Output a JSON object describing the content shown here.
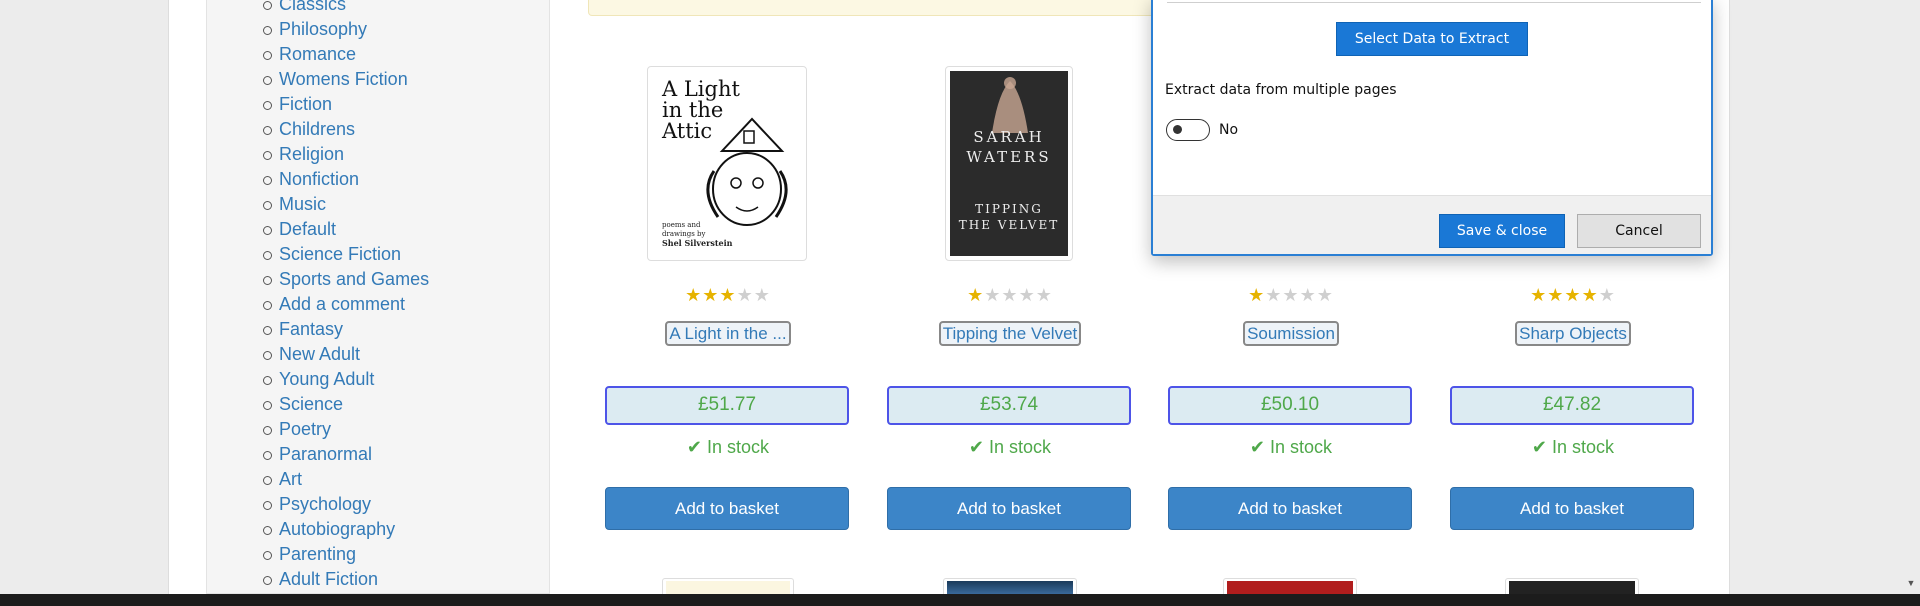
{
  "sidebar": {
    "categories": [
      "Classics",
      "Philosophy",
      "Romance",
      "Womens Fiction",
      "Fiction",
      "Childrens",
      "Religion",
      "Nonfiction",
      "Music",
      "Default",
      "Science Fiction",
      "Sports and Games",
      "Add a comment",
      "Fantasy",
      "New Adult",
      "Young Adult",
      "Science",
      "Poetry",
      "Paranormal",
      "Art",
      "Psychology",
      "Autobiography",
      "Parenting",
      "Adult Fiction"
    ]
  },
  "products": [
    {
      "title": "A Light in the ...",
      "price": "£51.77",
      "stock": "In stock",
      "button": "Add to basket",
      "rating": 3,
      "cover": {
        "line1": "A Light",
        "line2": "in the",
        "line3": "Attic",
        "small1": "poems and",
        "small2": "drawings by",
        "author": "Shel Silverstein"
      }
    },
    {
      "title": "Tipping the Velvet",
      "price": "£53.74",
      "stock": "In stock",
      "button": "Add to basket",
      "rating": 1,
      "cover": {
        "author1": "SARAH",
        "author2": "WATERS",
        "title1": "TIPPING",
        "title2": "THE VELVET"
      }
    },
    {
      "title": "Soumission",
      "price": "£50.10",
      "stock": "In stock",
      "button": "Add to basket",
      "rating": 1
    },
    {
      "title": "Sharp Objects",
      "price": "£47.82",
      "stock": "In stock",
      "button": "Add to basket",
      "rating": 4
    }
  ],
  "dialog": {
    "select_button": "Select Data to Extract",
    "multi_page_label": "Extract data from multiple pages",
    "toggle_value": "No",
    "save_button": "Save & close",
    "cancel_button": "Cancel"
  },
  "colors": {
    "link": "#337ab7",
    "price": "#4fa84a",
    "button": "#3c85c8",
    "dialog_accent": "#1a78d6",
    "star": "#e6b300"
  },
  "icons": {
    "check": "check-icon",
    "star": "star-icon",
    "bullet": "circle-bullet-icon"
  }
}
